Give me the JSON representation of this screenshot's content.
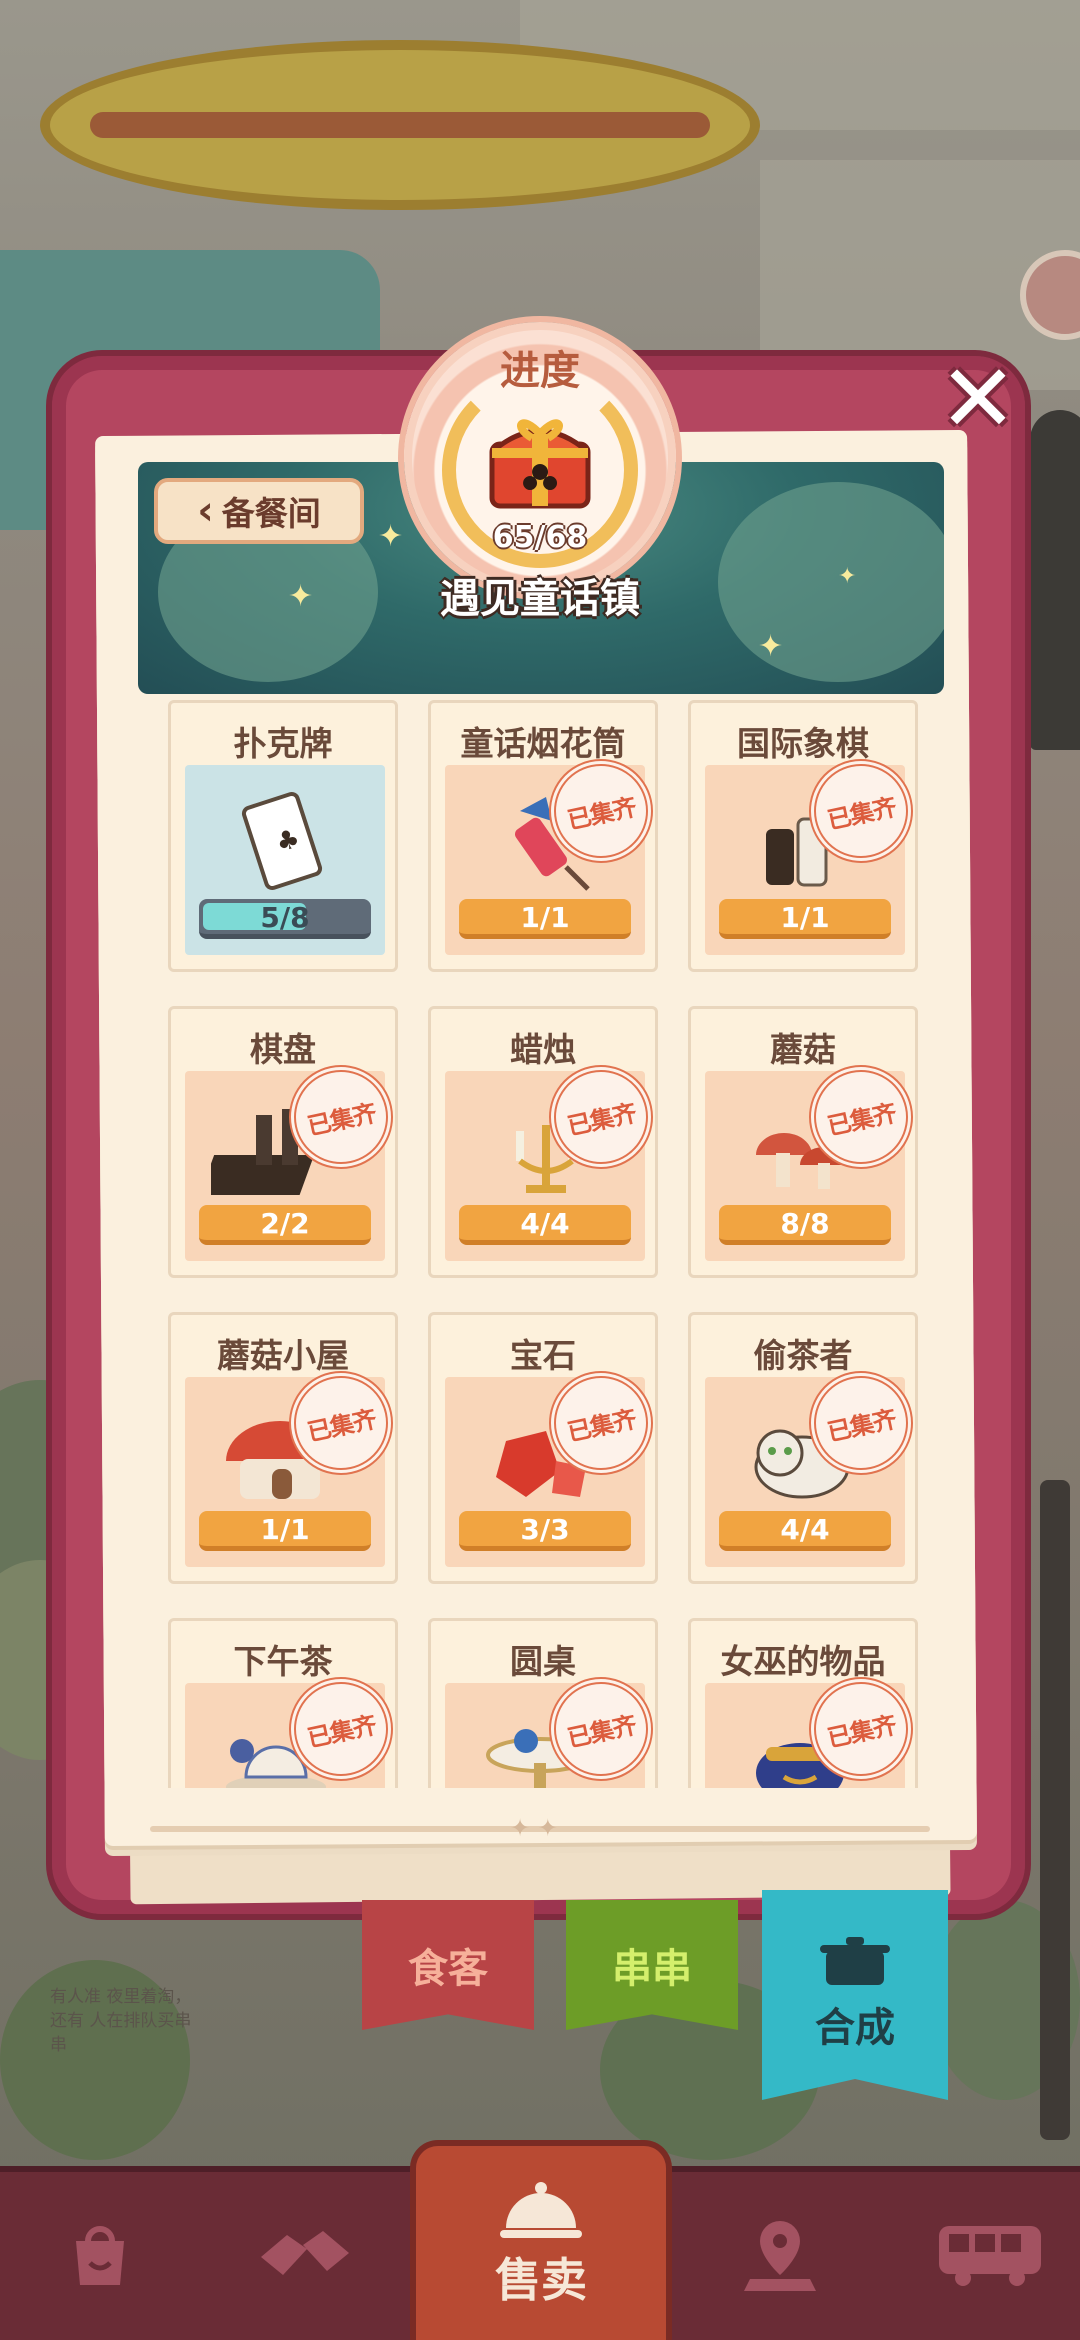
{
  "popup": {
    "back_label": "备餐间",
    "progress_title": "进度",
    "progress_count": "65/68",
    "collection_name": "遇见童话镇"
  },
  "items": [
    {
      "name": "扑克牌",
      "progress": "5/8",
      "fraction": 0.625,
      "collected": false,
      "icon": "playing-card"
    },
    {
      "name": "童话烟花筒",
      "progress": "1/1",
      "fraction": 1,
      "collected": true,
      "icon": "firework-rocket"
    },
    {
      "name": "国际象棋",
      "progress": "1/1",
      "fraction": 1,
      "collected": true,
      "icon": "chess-pieces"
    },
    {
      "name": "棋盘",
      "progress": "2/2",
      "fraction": 1,
      "collected": true,
      "icon": "chess-board"
    },
    {
      "name": "蜡烛",
      "progress": "4/4",
      "fraction": 1,
      "collected": true,
      "icon": "candelabra"
    },
    {
      "name": "蘑菇",
      "progress": "8/8",
      "fraction": 1,
      "collected": true,
      "icon": "mushrooms"
    },
    {
      "name": "蘑菇小屋",
      "progress": "1/1",
      "fraction": 1,
      "collected": true,
      "icon": "mushroom-house"
    },
    {
      "name": "宝石",
      "progress": "3/3",
      "fraction": 1,
      "collected": true,
      "icon": "gems"
    },
    {
      "name": "偷茶者",
      "progress": "4/4",
      "fraction": 1,
      "collected": true,
      "icon": "tabby-cat"
    },
    {
      "name": "下午茶",
      "progress": "",
      "fraction": 1,
      "collected": true,
      "icon": "afternoon-tea"
    },
    {
      "name": "圆桌",
      "progress": "",
      "fraction": 1,
      "collected": true,
      "icon": "round-table"
    },
    {
      "name": "女巫的物品",
      "progress": "",
      "fraction": 1,
      "collected": true,
      "icon": "witch-pot"
    }
  ],
  "stamp_label": "已集齐",
  "tabs": {
    "diner": "食客",
    "skewer": "串串",
    "synthesize": "合成"
  },
  "nav": {
    "center_label": "售卖",
    "icons": [
      "bag-icon",
      "hands-icon",
      "bell-icon",
      "map-pin-icon",
      "bus-icon"
    ]
  },
  "scene_note": "有人准 夜里着淘，还有 人在排队买串串",
  "colors": {
    "frame": "#b44660",
    "accent_orange": "#f1a441",
    "stamp_red": "#dc5c3d",
    "teal": "#34b9c7"
  }
}
